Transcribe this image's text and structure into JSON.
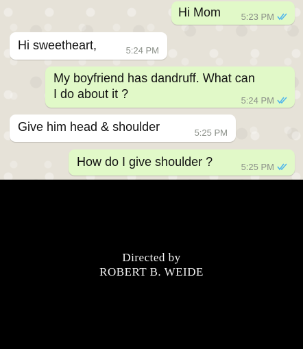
{
  "messages": [
    {
      "direction": "outgoing",
      "text": "Hi Mom",
      "time": "5:23 PM",
      "status": "read"
    },
    {
      "direction": "incoming",
      "text": "Hi sweetheart,",
      "time": "5:24 PM"
    },
    {
      "direction": "outgoing",
      "lines": [
        "My boyfriend has dandruff. What can",
        "I do about it ?"
      ],
      "time": "5:24 PM",
      "status": "read"
    },
    {
      "direction": "incoming",
      "text": "Give him head & shoulder",
      "time": "5:25 PM"
    },
    {
      "direction": "outgoing",
      "text": "How do I give shoulder ?",
      "time": "5:25 PM",
      "status": "read"
    }
  ],
  "credits": {
    "line1": "Directed by",
    "line2": "ROBERT B. WEIDE"
  },
  "colors": {
    "outgoing_bubble": "#e1f9c8",
    "incoming_bubble": "#ffffff",
    "read_ticks": "#4fb6ec",
    "chat_background": "#e6e2d8",
    "credits_background": "#000000"
  }
}
